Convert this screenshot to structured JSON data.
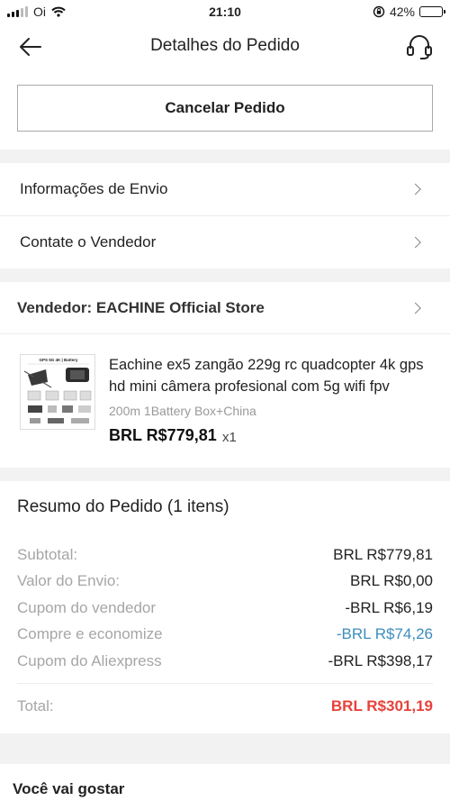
{
  "status_bar": {
    "carrier": "Oi",
    "time": "21:10",
    "battery_percent": "42%",
    "battery_level": 0.42,
    "icons": [
      "signal-icon",
      "wifi-icon",
      "orientation-lock-icon",
      "battery-icon"
    ]
  },
  "nav": {
    "title": "Detalhes do Pedido",
    "back_icon": "back-arrow-icon",
    "support_icon": "headset-support-icon"
  },
  "actions": {
    "cancel_label": "Cancelar Pedido"
  },
  "links": [
    {
      "label": "Informações de Envio"
    },
    {
      "label": "Contate o Vendedor"
    }
  ],
  "seller": {
    "label": "Vendedor: EACHINE Official Store"
  },
  "product": {
    "title": "Eachine ex5 zangão 229g rc quadcopter 4k gps hd mini câmera profesional com 5g wifi fpv",
    "variant": "200m 1Battery Box+China",
    "price": "BRL R$779,81",
    "quantity": "x1",
    "thumb_label": "GPS 5G 4K | Battery"
  },
  "summary": {
    "title": "Resumo do Pedido (1 itens)",
    "rows": [
      {
        "label": "Subtotal:",
        "value": "BRL R$779,81"
      },
      {
        "label": "Valor do Envio:",
        "value": "BRL R$0,00"
      },
      {
        "label": "Cupom do vendedor",
        "value": "-BRL R$6,19"
      },
      {
        "label": "Compre e economize",
        "value": "-BRL R$74,26"
      },
      {
        "label": "Cupom do Aliexpress",
        "value": "-BRL R$398,17"
      }
    ],
    "total_label": "Total:",
    "total_value": "BRL R$301,19"
  },
  "recommend": {
    "title": "Você vai gostar"
  },
  "colors": {
    "total_red": "#e8423a",
    "discount_blue": "#3d8dbd",
    "muted_label": "#a6a6a6",
    "page_bg": "#f2f2f2"
  }
}
